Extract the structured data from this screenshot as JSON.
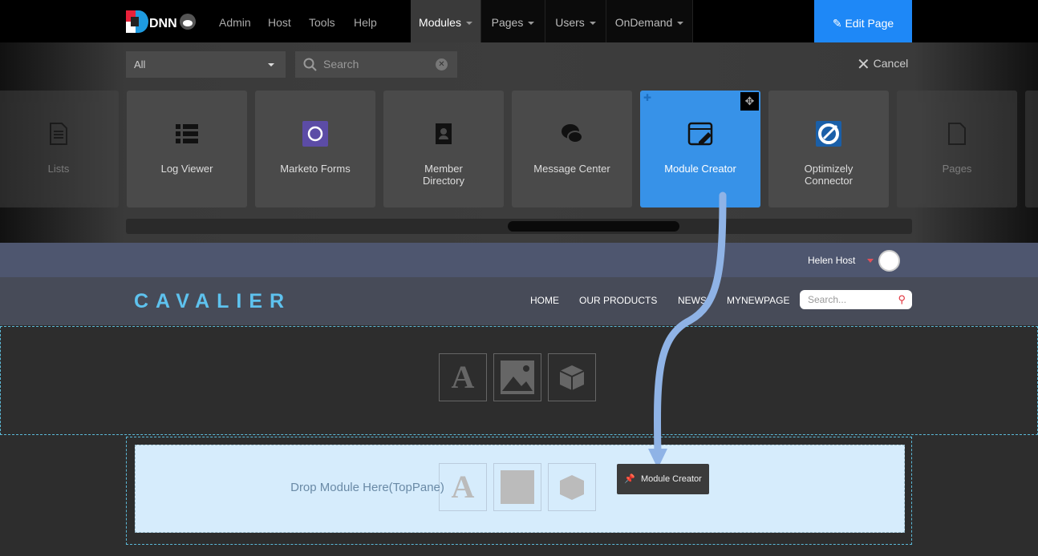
{
  "topbar": {
    "logo_text": "dnn",
    "nav": [
      "Admin",
      "Host",
      "Tools",
      "Help"
    ],
    "tabs": [
      "Modules",
      "Pages",
      "Users",
      "OnDemand"
    ],
    "edit_page": "Edit Page"
  },
  "panel": {
    "filter": "All",
    "search_placeholder": "Search",
    "cancel": "Cancel",
    "tiles": [
      "Lists",
      "Log Viewer",
      "Marketo Forms",
      "Member Directory",
      "Message Center",
      "Module Creator",
      "Optimizely Connector",
      "Pages"
    ]
  },
  "user": {
    "name": "Helen Host"
  },
  "site": {
    "brand": "CAVALIER",
    "menu": [
      "HOME",
      "OUR PRODUCTS",
      "NEWS",
      "MYNEWPAGE"
    ],
    "search_placeholder": "Search..."
  },
  "drop": {
    "text": "Drop Module Here(TopPane)",
    "tooltip": "Module Creator"
  },
  "colors": {
    "accent": "#1e88f7",
    "selected_tile": "#3792e8",
    "brand": "#5ec2ee"
  }
}
